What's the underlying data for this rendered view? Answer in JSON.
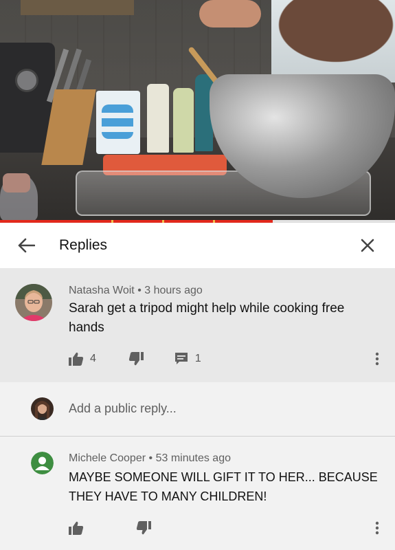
{
  "header": {
    "title": "Replies"
  },
  "video": {
    "progress": 0.69
  },
  "comments": [
    {
      "author": "Natasha Woit",
      "separator": "•",
      "time": "3 hours ago",
      "text": "Sarah get a tripod might help while cooking free hands",
      "likes": "4",
      "replies": "1"
    },
    {
      "author": "Michele Cooper",
      "separator": "•",
      "time": "53 minutes ago",
      "text": "MAYBE SOMEONE WILL GIFT IT TO HER... BECAUSE THEY HAVE TO MANY CHILDREN!",
      "likes": "",
      "replies": ""
    }
  ],
  "reply_box": {
    "placeholder": "Add a public reply..."
  },
  "colors": {
    "progress": "#e5291c",
    "accent_avatar": "#3e8e41",
    "icon": "#606060"
  },
  "icons": {
    "back": "arrow-left-icon",
    "close": "close-icon",
    "like": "thumbs-up-icon",
    "dislike": "thumbs-down-icon",
    "reply": "comment-icon",
    "more": "more-vert-icon"
  }
}
